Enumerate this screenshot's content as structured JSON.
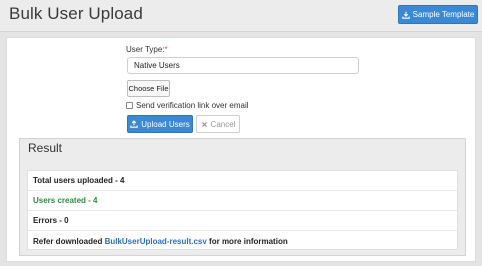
{
  "header": {
    "title": "Bulk User Upload",
    "sample_template_label": "Sample Template",
    "sample_icon": "download-icon"
  },
  "form": {
    "user_type_label": "User Type:",
    "required_mark": "*",
    "user_type_value": "Native Users",
    "choose_file_label": "Choose File",
    "verification_label": "Send verification link over email",
    "verification_checked": false,
    "upload_label": "Upload Users",
    "upload_icon": "upload-icon",
    "cancel_label": "Cancel",
    "cancel_icon": "close-icon"
  },
  "result": {
    "heading": "Result",
    "total_uploaded": "Total users uploaded - 4",
    "users_created": "Users created - 4",
    "errors": "Errors - 0",
    "info_prefix": "Refer downloaded ",
    "info_link": "BulkUserUpload-result.csv",
    "info_suffix": " for more information"
  },
  "colors": {
    "primary": "#3b88d4",
    "success": "#2e8b3e",
    "link": "#2a6fb8",
    "required": "#d9534f"
  }
}
